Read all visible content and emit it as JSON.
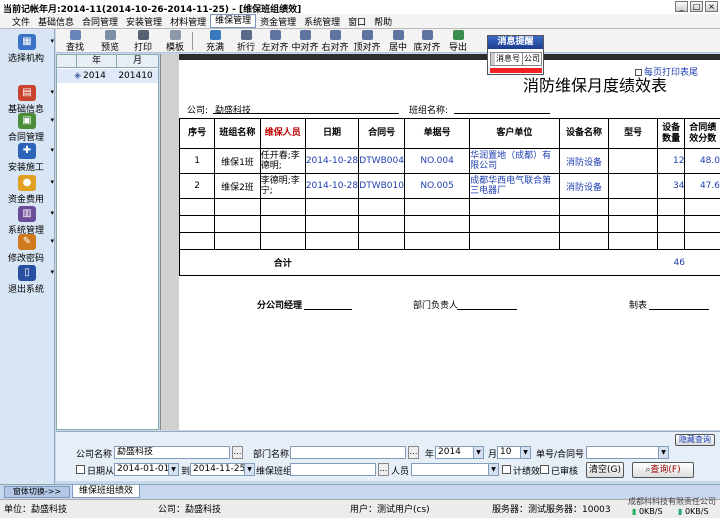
{
  "window": {
    "title": "当前记帐年月:2014-11(2014-10-26-2014-11-25) - [维保班组绩效]"
  },
  "menu": [
    "文件",
    "基础信息",
    "合同管理",
    "安装管理",
    "材料管理",
    "维保管理",
    "资金管理",
    "系统管理",
    "窗口",
    "帮助"
  ],
  "menu_active_index": 5,
  "sidebar": [
    {
      "label": "选择机构",
      "icon": "building-icon",
      "color": "#3a72c8"
    },
    {
      "label": "基础信息",
      "icon": "database-icon",
      "color": "#c9442e"
    },
    {
      "label": "合同管理",
      "icon": "contract-icon",
      "color": "#4b8d3a"
    },
    {
      "label": "安装施工",
      "icon": "install-icon",
      "color": "#2b63b8"
    },
    {
      "label": "资金费用",
      "icon": "coins-icon",
      "color": "#e0a020"
    },
    {
      "label": "系统管理",
      "icon": "system-icon",
      "color": "#6b4c9a"
    },
    {
      "label": "修改密码",
      "icon": "key-icon",
      "color": "#d07a20"
    },
    {
      "label": "退出系统",
      "icon": "exit-icon",
      "color": "#2850a0"
    }
  ],
  "toolbar": [
    "查找",
    "预览",
    "打印",
    "模板",
    "充满",
    "折行",
    "左对齐",
    "中对齐",
    "右对齐",
    "顶对齐",
    "居中",
    "底对齐",
    "导出"
  ],
  "left_grid": {
    "col_year": "年",
    "col_month": "月",
    "row_year": "2014",
    "row_month": "201410"
  },
  "report": {
    "title": "消防维保月度绩效表",
    "print_checkbox_label": "每页打印表尾",
    "company_label": "公司:",
    "company_value": "勐盛科技",
    "team_label": "班组名称:",
    "headers": [
      "序号",
      "班组名称",
      "维保人员",
      "日期",
      "合同号",
      "单据号",
      "客户单位",
      "设备名称",
      "型号",
      "设备数量",
      "合同绩效分数"
    ],
    "rows": [
      [
        "1",
        "维保1班",
        "任开春;李德明;",
        "2014-10-28",
        "DTWB004",
        "NO.004",
        "华润置地（成都）有限公司",
        "消防设备",
        "",
        "12",
        "48.0"
      ],
      [
        "2",
        "维保2班",
        "李德明;李宁;",
        "2014-10-28",
        "DTWB010",
        "NO.005",
        "成都华西电气联合第三电器厂",
        "消防设备",
        "",
        "34",
        "47.6"
      ]
    ],
    "total_label": "合计",
    "total_qty": "46",
    "sig_manager": "分公司经理",
    "sig_dept": "部门负责人",
    "sig_maker": "制表"
  },
  "popup": {
    "title": "消息提醒",
    "col": "消息号",
    "col2": "公司"
  },
  "query": {
    "company_label": "公司名称",
    "company_value": "勐盛科技",
    "dept_label": "部门名称",
    "dept_value": "",
    "year_label": "年",
    "year_value": "2014",
    "month_label": "月",
    "month_value": "10",
    "doc_label": "单号/合同号",
    "doc_value": "",
    "date_from_label": "日期从",
    "date_from": "2014-01-01",
    "to_label": "到",
    "date_to": "2014-11-25",
    "team_label": "维保班组",
    "team_value": "",
    "person_label": "人员",
    "person_value": "",
    "chk_jx": "计绩效",
    "chk_sh": "已审核",
    "clear_btn": "清空(G)",
    "query_btn": "查询(F)",
    "hide_query": "隐藏查询"
  },
  "tabs": {
    "switch": "窗体切换->>",
    "active": "维保班组绩效"
  },
  "status": {
    "unit": "单位：勐盛科技",
    "company": "公司：勐盛科技",
    "user": "用户：测试用户(cs)",
    "server": "服务器：测试服务器：10003",
    "vendor": "成都科科技有限责任公司",
    "up": "0KB/S",
    "down": "0KB/S"
  }
}
